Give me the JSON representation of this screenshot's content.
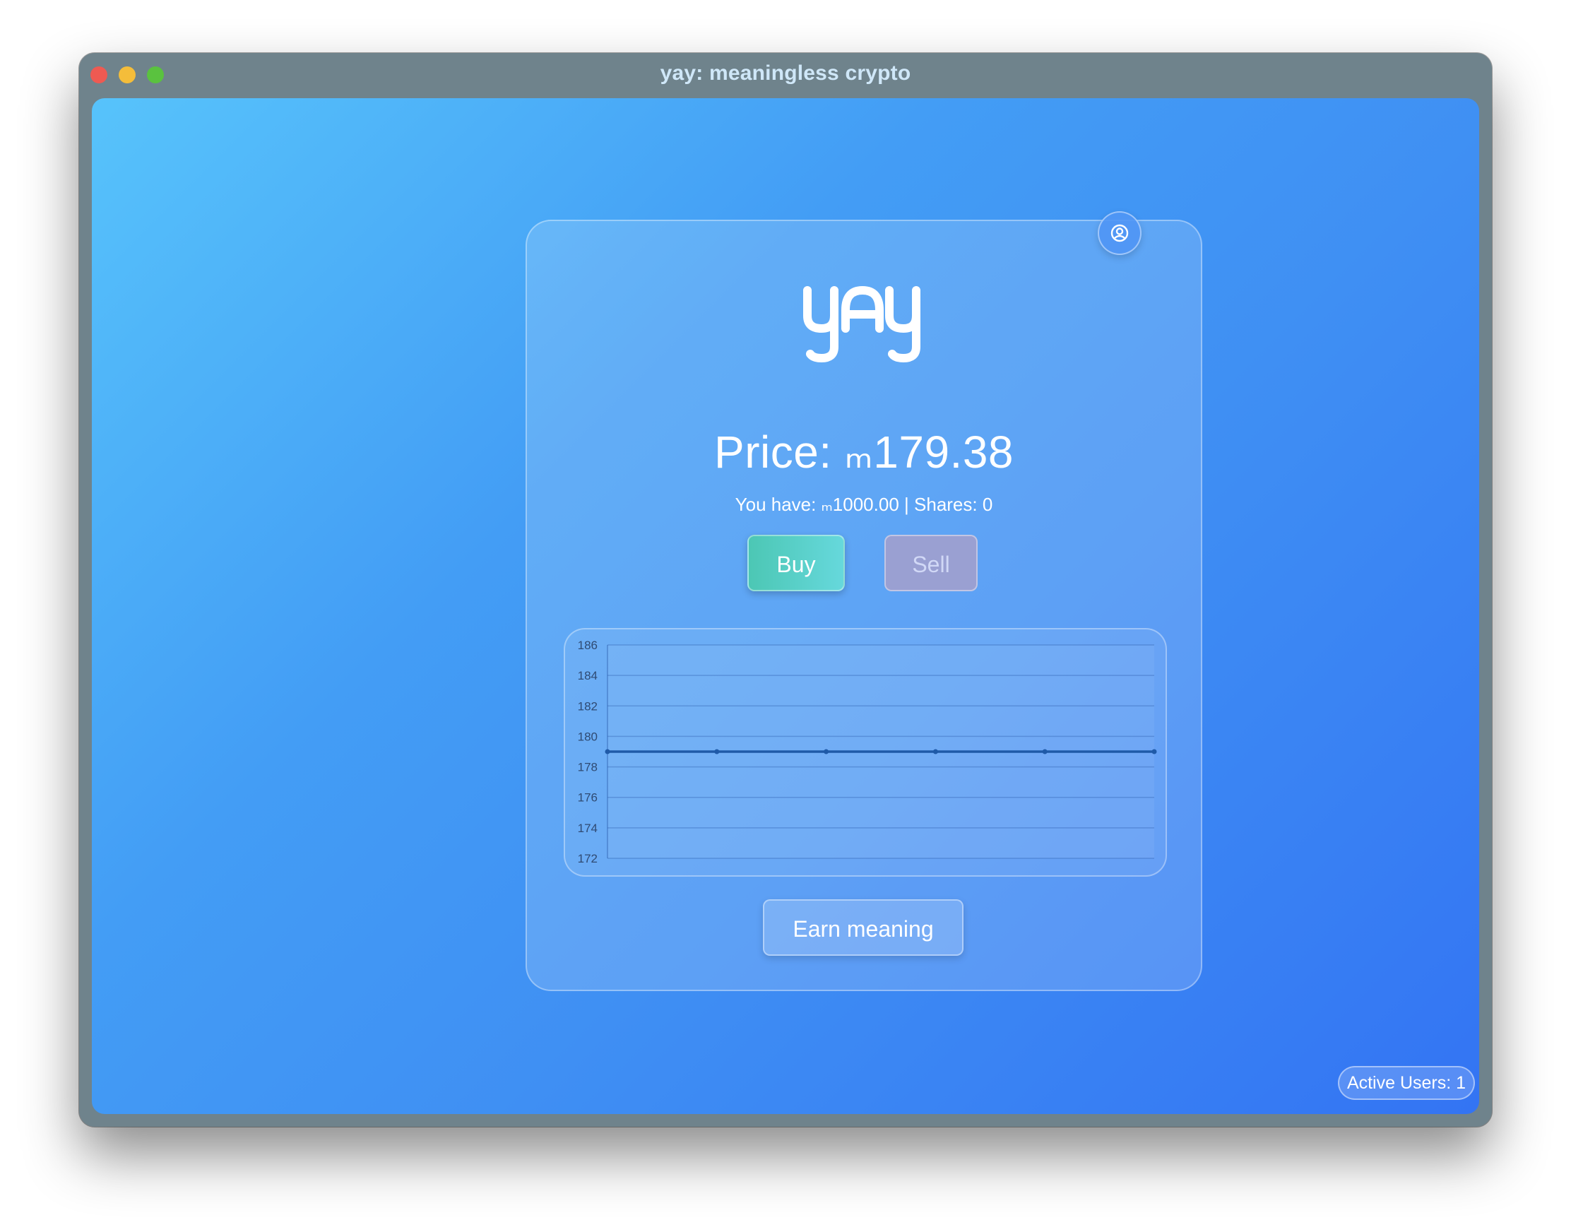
{
  "window": {
    "title": "yay: meaningless crypto"
  },
  "app": {
    "logo_text": "yay",
    "price_label": "Price:",
    "currency_symbol": "ₘ",
    "price_value": "179.38",
    "balance_label": "You have:",
    "balance_value": "1000.00",
    "shares_label": "Shares:",
    "shares_value": "0",
    "buy_label": "Buy",
    "sell_label": "Sell",
    "earn_label": "Earn meaning",
    "active_users_label": "Active Users:",
    "active_users_value": "1",
    "user_icon": "user-circle-icon"
  },
  "chart_data": {
    "type": "line",
    "x": [
      1,
      2,
      3,
      4,
      5,
      6
    ],
    "values": [
      179,
      179,
      179,
      179,
      179,
      179
    ],
    "ylim": [
      172,
      186
    ],
    "y_ticks": [
      "172",
      "174",
      "176",
      "178",
      "180",
      "182",
      "184",
      "186"
    ],
    "grid": true,
    "line_color": "#1f5aa8"
  }
}
